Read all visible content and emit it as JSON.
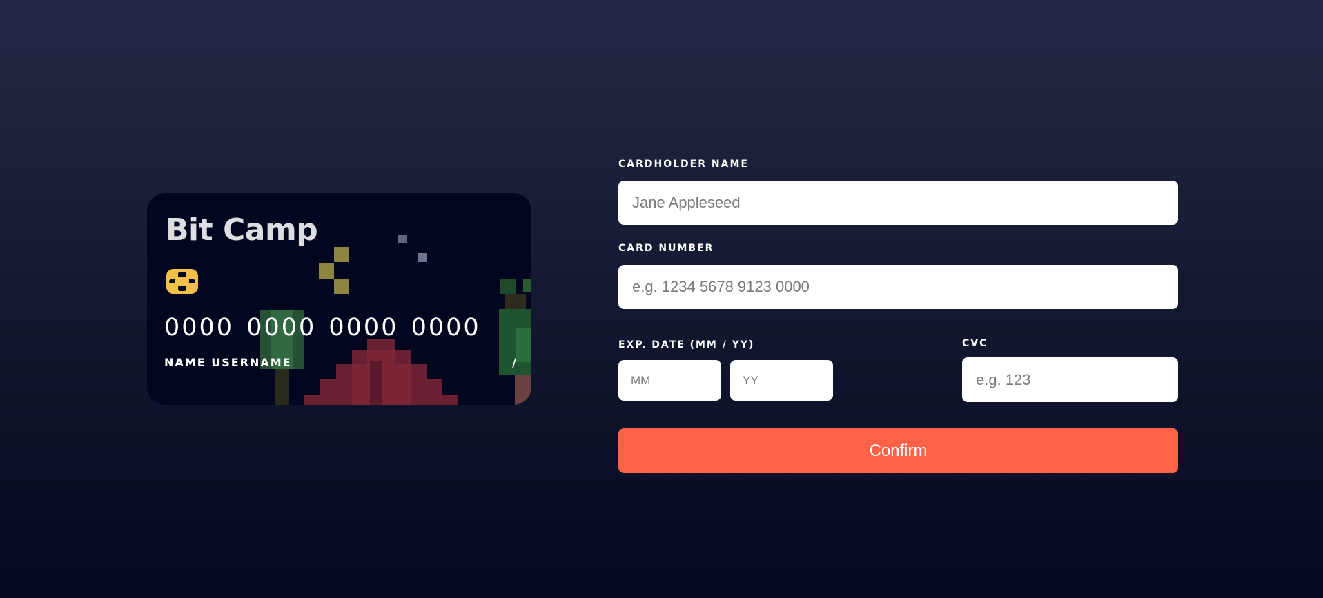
{
  "card": {
    "brand": "Bit Camp",
    "number": "0000 0000 0000 0000",
    "name": "NAME USERNAME",
    "expiry": "/",
    "chip_icon": "card-chip-icon",
    "scene": "pixel-art-campsite"
  },
  "form": {
    "cardholder": {
      "label": "CARDHOLDER NAME",
      "placeholder": "Jane Appleseed",
      "value": ""
    },
    "number": {
      "label": "CARD NUMBER",
      "placeholder": "e.g. 1234 5678 9123 0000",
      "value": ""
    },
    "expiry": {
      "label": "EXP. DATE (MM / YY)",
      "month_placeholder": "MM",
      "year_placeholder": "YY"
    },
    "cvc": {
      "label": "CVC",
      "placeholder": "e.g. 123",
      "value": ""
    },
    "confirm_label": "Confirm"
  },
  "colors": {
    "background_top": "#232945",
    "background_bottom": "#040a22",
    "card_background": "#02071f",
    "accent": "#ff6247",
    "chip": "#f3c14a",
    "input_background": "#ffffff"
  }
}
